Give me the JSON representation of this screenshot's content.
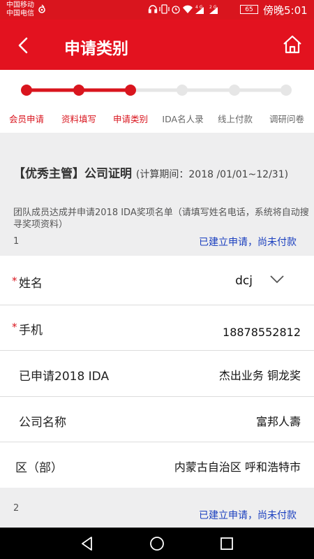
{
  "status_bar": {
    "carrier_1": "中国移动",
    "carrier_2": "中国电信",
    "carrier_icon": "signal-swirl-icon",
    "net_1": "4G",
    "net_2": "2G",
    "battery": "65",
    "time": "傍晚5:01"
  },
  "header": {
    "title": "申请类别",
    "back_icon": "back-chevron-icon",
    "home_icon": "home-icon"
  },
  "steps": {
    "items": [
      {
        "label": "会员申请",
        "state": "done"
      },
      {
        "label": "资料填写",
        "state": "done"
      },
      {
        "label": "申请类别",
        "state": "current"
      },
      {
        "label": "IDA名人录",
        "state": "todo"
      },
      {
        "label": "线上付款",
        "state": "todo"
      },
      {
        "label": "调研问卷",
        "state": "todo"
      }
    ],
    "active_color": "#d9151e",
    "inactive_color": "#e6e6e6"
  },
  "company_cert": {
    "title": "【优秀主管】公司证明",
    "period": "(计算期间：2018 /01/01~12/31)"
  },
  "instruction": "团队成员达成并申请2018 IDA奖项名单（请填写姓名电话，系统将自动搜寻奖项资料）",
  "members": [
    {
      "number": "1",
      "status": "已建立申请，尚未付款",
      "fields": {
        "name": {
          "label": "姓名",
          "value": "dcj",
          "required": "*"
        },
        "phone": {
          "label": "手机",
          "value": "18878552812",
          "required": "*"
        },
        "applied": {
          "label": "已申请2018 IDA",
          "value": "杰出业务 铜龙奖"
        },
        "company": {
          "label": "公司名称",
          "value": "富邦人壽"
        },
        "district": {
          "label": "区（部）",
          "value": "内蒙古自治区 呼和浩特市"
        }
      }
    },
    {
      "number": "2",
      "status": "已建立申请，尚未付款"
    }
  ],
  "nav": {
    "back": "nav-back-icon",
    "home": "nav-home-icon",
    "recent": "nav-recent-icon"
  }
}
